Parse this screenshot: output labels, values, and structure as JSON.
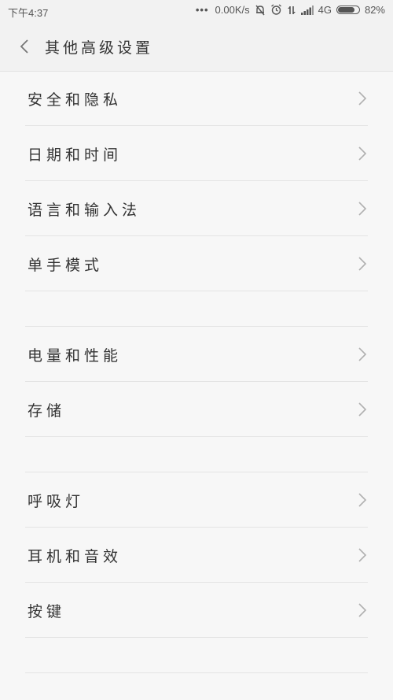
{
  "status_bar": {
    "time": "下午4:37",
    "dots": "•••",
    "network_speed": "0.00K/s",
    "network_type": "4G",
    "battery_percent_text": "82%",
    "battery_level": 0.82
  },
  "header": {
    "title": "其他高级设置",
    "back_icon": "chevron-left-icon"
  },
  "sections": [
    {
      "items": [
        {
          "label": "安全和隐私"
        },
        {
          "label": "日期和时间"
        },
        {
          "label": "语言和输入法"
        },
        {
          "label": "单手模式"
        }
      ]
    },
    {
      "items": [
        {
          "label": "电量和性能"
        },
        {
          "label": "存储"
        }
      ]
    },
    {
      "items": [
        {
          "label": "呼吸灯"
        },
        {
          "label": "耳机和音效"
        },
        {
          "label": "按键"
        }
      ]
    }
  ],
  "colors": {
    "background": "#f7f7f7",
    "divider": "#e4e4e4",
    "text": "#333333",
    "chevron": "#b0b0b0"
  }
}
